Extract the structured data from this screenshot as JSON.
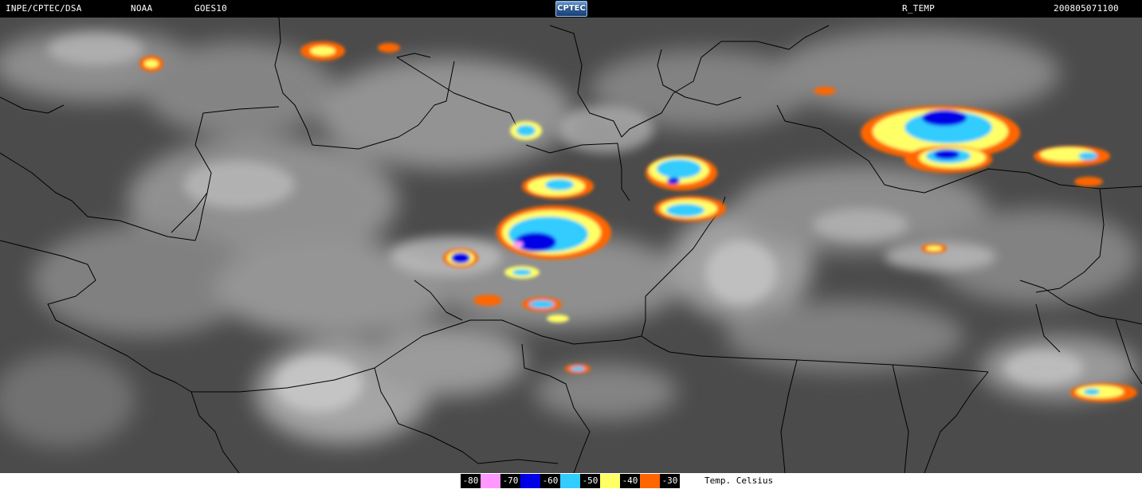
{
  "header": {
    "source": "INPE/CPTEC/DSA",
    "agency": "NOAA",
    "satellite": "GOES10",
    "product": "R_TEMP",
    "timestamp": "200805071100",
    "logo_text": "CPTEC"
  },
  "map": {
    "background_color": "#4b4b4b",
    "border_color": "#000000",
    "cloud_shades": [
      "#8e8e8e",
      "#a6a6a6",
      "#bdbdbd"
    ]
  },
  "legend": {
    "title": "Temp. Celsius",
    "entries": [
      {
        "label": "-80",
        "color": "#ff99ff"
      },
      {
        "label": "-70",
        "color": "#0000e6"
      },
      {
        "label": "-60",
        "color": "#33ccff"
      },
      {
        "label": "-50",
        "color": "#ffff66"
      },
      {
        "label": "-40",
        "color": "#ff6600"
      },
      {
        "label": "-30",
        "color": "#ffffff"
      }
    ]
  }
}
